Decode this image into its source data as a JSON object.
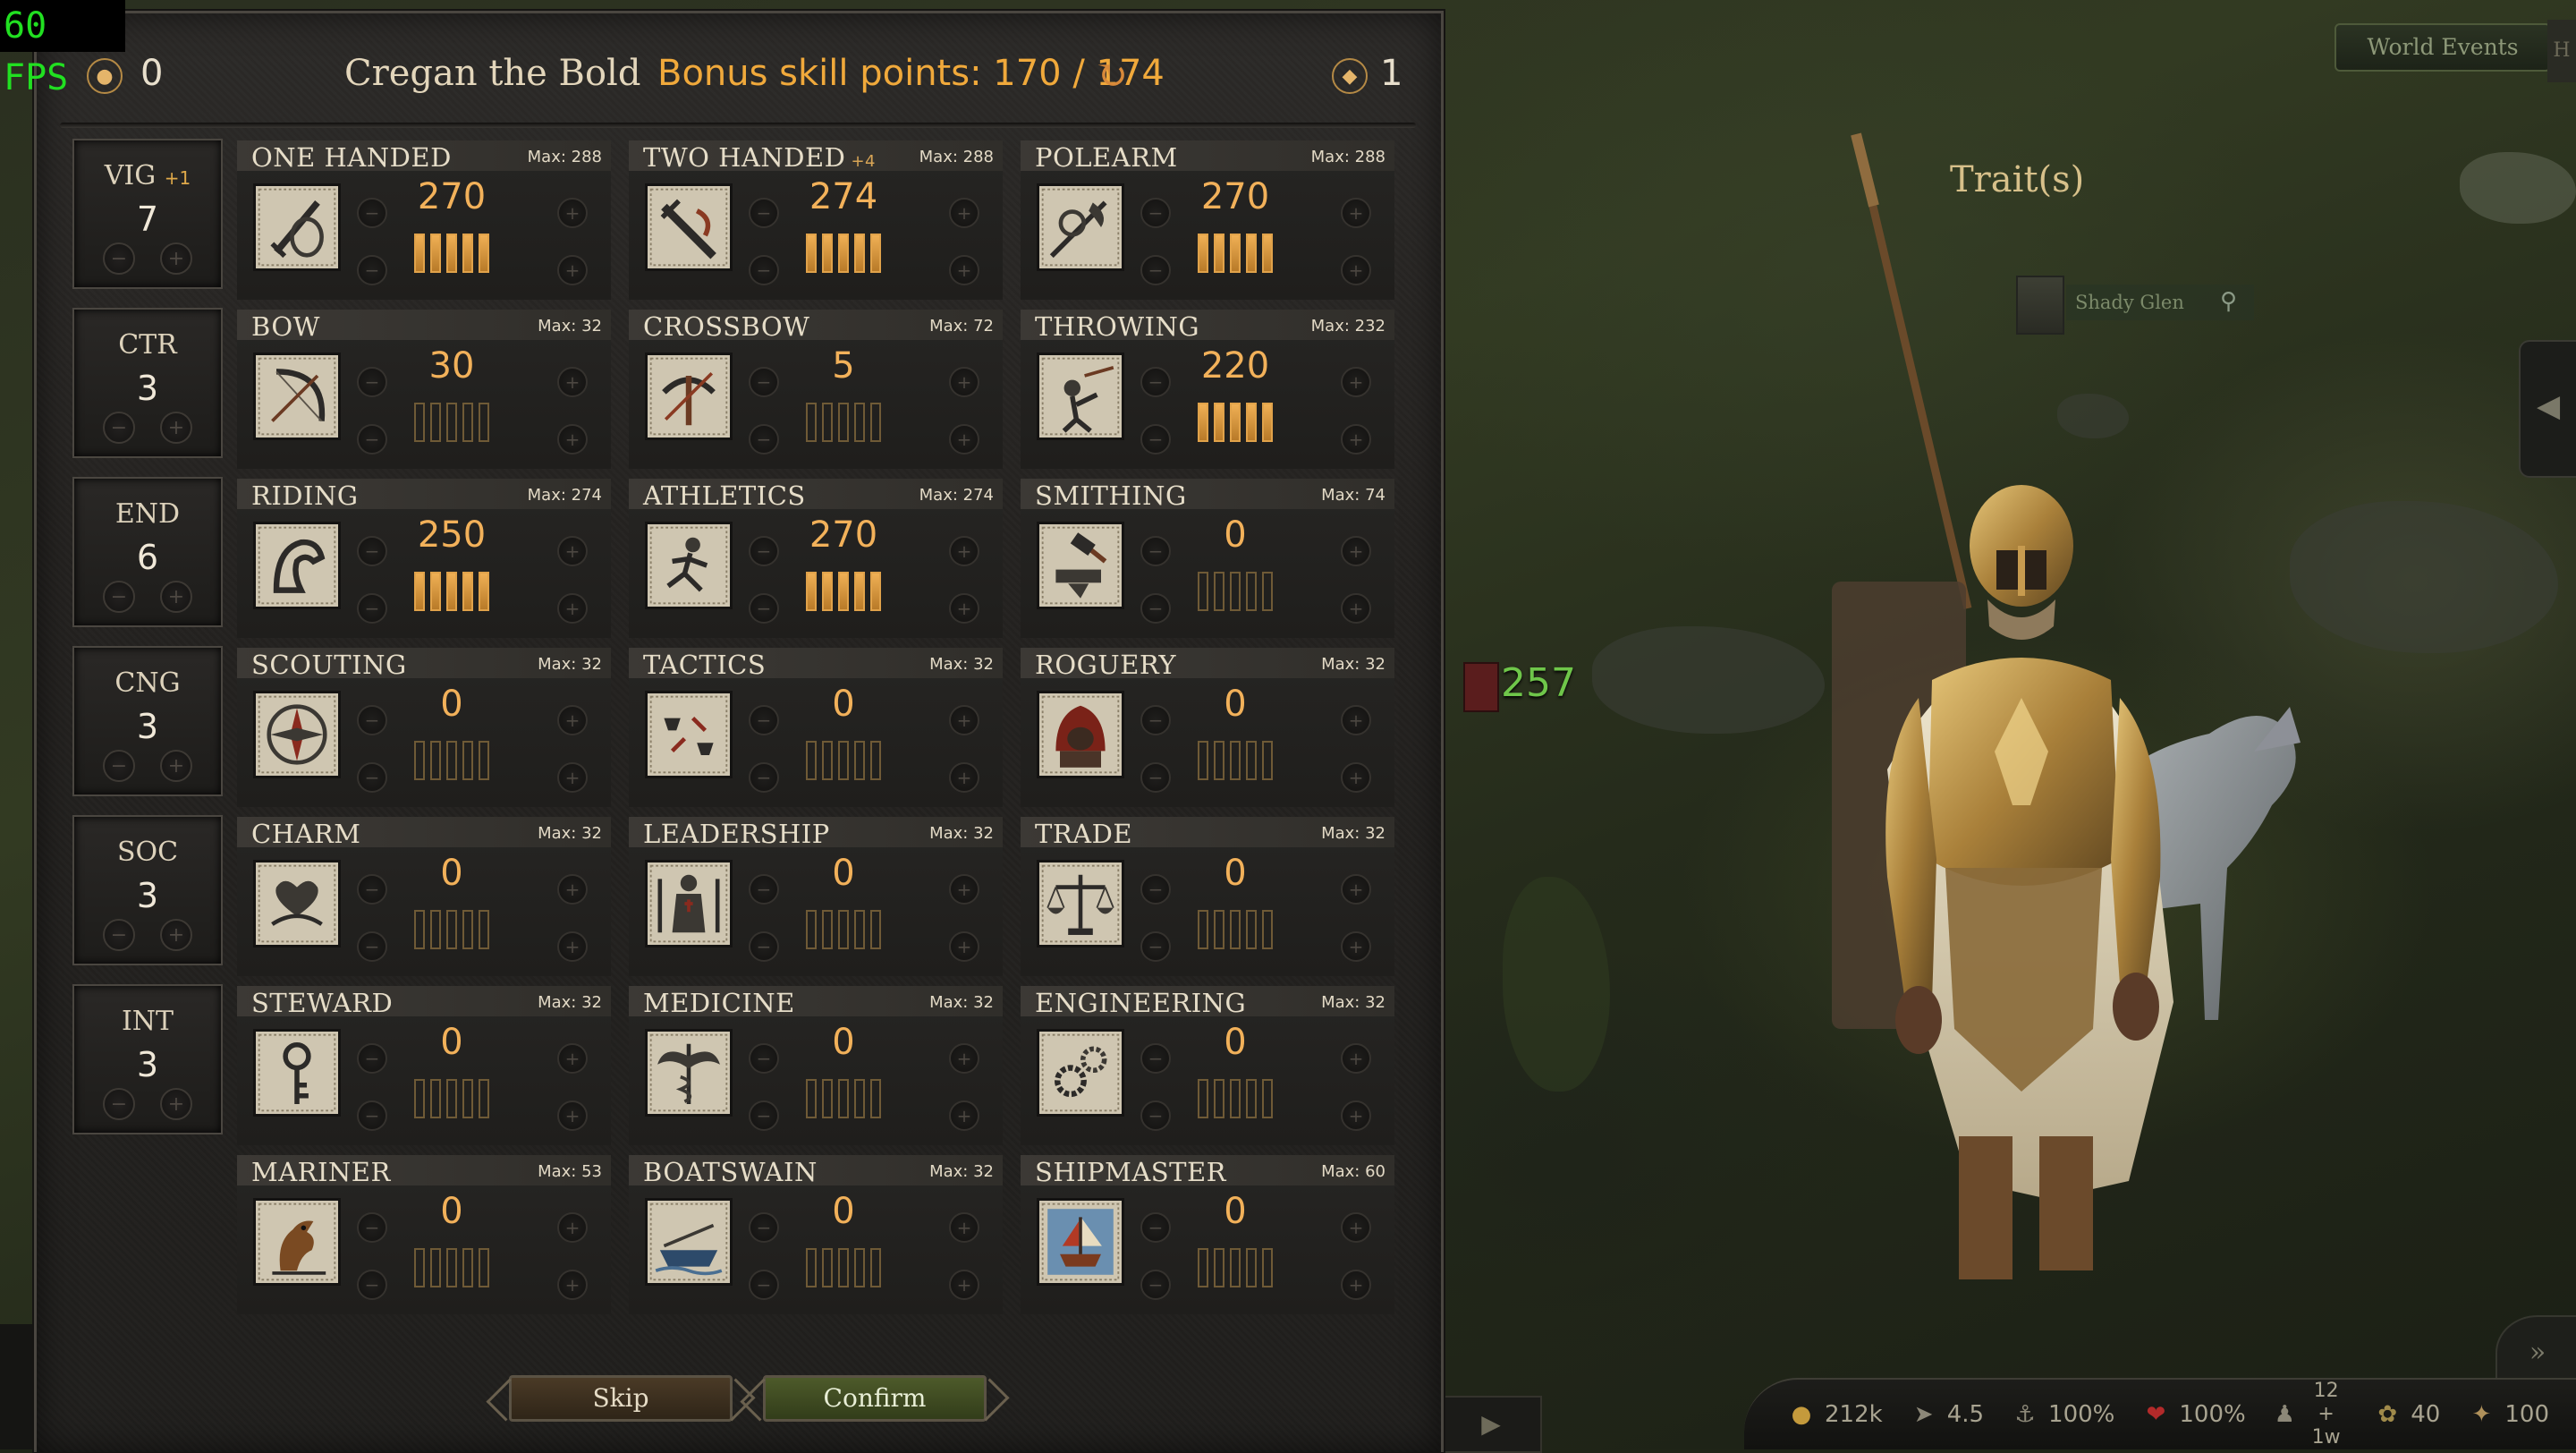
{
  "overlay": {
    "fps": "60 FPS"
  },
  "world": {
    "world_events": "World Events",
    "edge_tab": "H",
    "trait_label": "Trait(s)",
    "settlement_name": "Shady Glen",
    "party_count": "257"
  },
  "header": {
    "gold": "0",
    "character_name": "Cregan the Bold",
    "bonus_label": "Bonus skill points: ",
    "bonus_value": "170 / 174",
    "gems": "1"
  },
  "attributes": [
    {
      "label": "VIG",
      "bonus": "+1",
      "value": "7"
    },
    {
      "label": "CTR",
      "bonus": "",
      "value": "3"
    },
    {
      "label": "END",
      "bonus": "",
      "value": "6"
    },
    {
      "label": "CNG",
      "bonus": "",
      "value": "3"
    },
    {
      "label": "SOC",
      "bonus": "",
      "value": "3"
    },
    {
      "label": "INT",
      "bonus": "",
      "value": "3"
    }
  ],
  "skills": [
    {
      "name": "ONE HANDED",
      "mod": "",
      "max": "Max: 288",
      "value": "270",
      "focus": 5,
      "icon": "one-handed-icon"
    },
    {
      "name": "TWO HANDED",
      "mod": "+4",
      "max": "Max: 288",
      "value": "274",
      "focus": 5,
      "icon": "two-handed-icon"
    },
    {
      "name": "POLEARM",
      "mod": "",
      "max": "Max: 288",
      "value": "270",
      "focus": 5,
      "icon": "polearm-icon"
    },
    {
      "name": "BOW",
      "mod": "",
      "max": "Max: 32",
      "value": "30",
      "focus": 0,
      "icon": "bow-icon"
    },
    {
      "name": "CROSSBOW",
      "mod": "",
      "max": "Max: 72",
      "value": "5",
      "focus": 0,
      "icon": "crossbow-icon"
    },
    {
      "name": "THROWING",
      "mod": "",
      "max": "Max: 232",
      "value": "220",
      "focus": 5,
      "icon": "throwing-icon"
    },
    {
      "name": "RIDING",
      "mod": "",
      "max": "Max: 274",
      "value": "250",
      "focus": 5,
      "icon": "riding-icon"
    },
    {
      "name": "ATHLETICS",
      "mod": "",
      "max": "Max: 274",
      "value": "270",
      "focus": 5,
      "icon": "athletics-icon"
    },
    {
      "name": "SMITHING",
      "mod": "",
      "max": "Max: 74",
      "value": "0",
      "focus": 0,
      "icon": "smithing-icon"
    },
    {
      "name": "SCOUTING",
      "mod": "",
      "max": "Max: 32",
      "value": "0",
      "focus": 0,
      "icon": "scouting-icon"
    },
    {
      "name": "TACTICS",
      "mod": "",
      "max": "Max: 32",
      "value": "0",
      "focus": 0,
      "icon": "tactics-icon"
    },
    {
      "name": "ROGUERY",
      "mod": "",
      "max": "Max: 32",
      "value": "0",
      "focus": 0,
      "icon": "roguery-icon"
    },
    {
      "name": "CHARM",
      "mod": "",
      "max": "Max: 32",
      "value": "0",
      "focus": 0,
      "icon": "charm-icon"
    },
    {
      "name": "LEADERSHIP",
      "mod": "",
      "max": "Max: 32",
      "value": "0",
      "focus": 0,
      "icon": "leadership-icon"
    },
    {
      "name": "TRADE",
      "mod": "",
      "max": "Max: 32",
      "value": "0",
      "focus": 0,
      "icon": "trade-icon"
    },
    {
      "name": "STEWARD",
      "mod": "",
      "max": "Max: 32",
      "value": "0",
      "focus": 0,
      "icon": "steward-icon"
    },
    {
      "name": "MEDICINE",
      "mod": "",
      "max": "Max: 32",
      "value": "0",
      "focus": 0,
      "icon": "medicine-icon"
    },
    {
      "name": "ENGINEERING",
      "mod": "",
      "max": "Max: 32",
      "value": "0",
      "focus": 0,
      "icon": "engineering-icon"
    },
    {
      "name": "MARINER",
      "mod": "",
      "max": "Max: 53",
      "value": "0",
      "focus": 0,
      "icon": "mariner-icon"
    },
    {
      "name": "BOATSWAIN",
      "mod": "",
      "max": "Max: 32",
      "value": "0",
      "focus": 0,
      "icon": "boatswain-icon"
    },
    {
      "name": "SHIPMASTER",
      "mod": "",
      "max": "Max: 60",
      "value": "0",
      "focus": 0,
      "icon": "shipmaster-icon"
    }
  ],
  "buttons": {
    "skip": "Skip",
    "confirm": "Confirm"
  },
  "status_bar": {
    "gold": "212k",
    "speed": "4.5",
    "food": "100%",
    "health": "100%",
    "troops_top": "12 +",
    "troops_bottom": "1w",
    "morale": "40",
    "influence": "100"
  },
  "colors": {
    "accent_orange": "#f0a93b",
    "focus_fill": "#f0b055",
    "party_green": "#6fc64a"
  }
}
